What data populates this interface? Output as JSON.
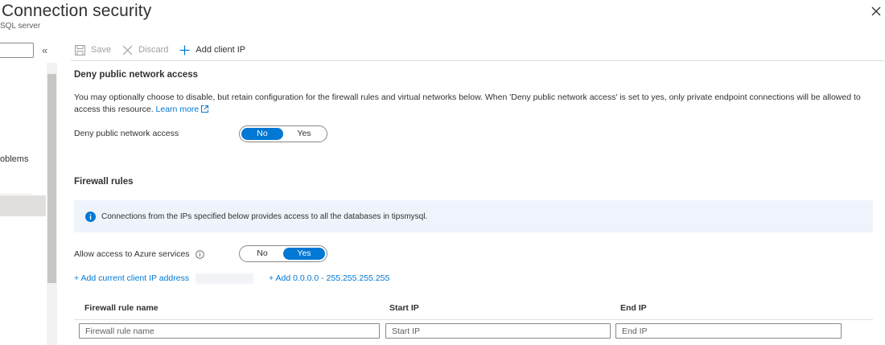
{
  "header": {
    "title": "Connection security",
    "subtitle": "SQL server",
    "close_icon": "close-icon"
  },
  "sidebar": {
    "collapse_label": "«",
    "partial_item_label": "oblems"
  },
  "toolbar": {
    "save_label": "Save",
    "discard_label": "Discard",
    "add_client_ip_label": "Add client IP"
  },
  "deny_public": {
    "section_title": "Deny public network access",
    "description": "You may optionally choose to disable, but retain configuration for the firewall rules and virtual networks below. When 'Deny public network access' is set to yes, only private endpoint connections will be allowed to access this resource.",
    "learn_more": "Learn more",
    "field_label": "Deny public network access",
    "options": [
      "No",
      "Yes"
    ],
    "selected": "No"
  },
  "firewall": {
    "section_title": "Firewall rules",
    "info_text": "Connections from the IPs specified below provides access to all the databases in tipsmysql.",
    "azure_label": "Allow access to Azure services",
    "azure_options": [
      "No",
      "Yes"
    ],
    "azure_selected": "Yes",
    "add_current_ip": "+ Add current client IP address",
    "add_all_range": "+ Add 0.0.0.0 - 255.255.255.255",
    "columns": [
      "Firewall rule name",
      "Start IP",
      "End IP"
    ],
    "placeholders": {
      "rule_name": "Firewall rule name",
      "start_ip": "Start IP",
      "end_ip": "End IP"
    }
  },
  "colors": {
    "accent": "#0078d4",
    "info_bg": "#eff3fb"
  }
}
